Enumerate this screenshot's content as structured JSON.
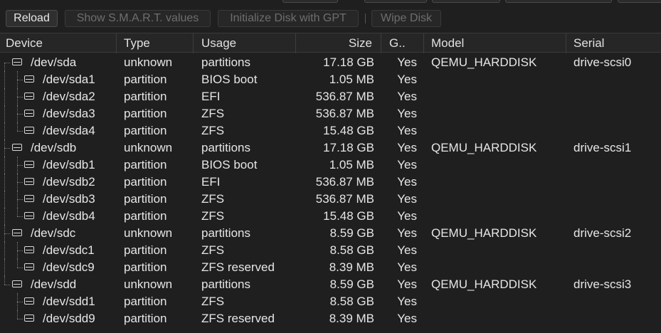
{
  "toolbar": {
    "reload": "Reload",
    "smart": "Show S.M.A.R.T. values",
    "init_gpt": "Initialize Disk with GPT",
    "wipe": "Wipe Disk"
  },
  "columns": {
    "device": "Device",
    "type": "Type",
    "usage": "Usage",
    "size": "Size",
    "gpt": "G..",
    "model": "Model",
    "serial": "Serial"
  },
  "rows": [
    {
      "device": "/dev/sda",
      "type": "unknown",
      "usage": "partitions",
      "size": "17.18 GB",
      "gpt": "Yes",
      "model": "QEMU_HARDDISK",
      "serial": "drive-scsi0"
    },
    {
      "device": "/dev/sda1",
      "type": "partition",
      "usage": "BIOS boot",
      "size": "1.05 MB",
      "gpt": "Yes",
      "model": "",
      "serial": ""
    },
    {
      "device": "/dev/sda2",
      "type": "partition",
      "usage": "EFI",
      "size": "536.87 MB",
      "gpt": "Yes",
      "model": "",
      "serial": ""
    },
    {
      "device": "/dev/sda3",
      "type": "partition",
      "usage": "ZFS",
      "size": "536.87 MB",
      "gpt": "Yes",
      "model": "",
      "serial": ""
    },
    {
      "device": "/dev/sda4",
      "type": "partition",
      "usage": "ZFS",
      "size": "15.48 GB",
      "gpt": "Yes",
      "model": "",
      "serial": ""
    },
    {
      "device": "/dev/sdb",
      "type": "unknown",
      "usage": "partitions",
      "size": "17.18 GB",
      "gpt": "Yes",
      "model": "QEMU_HARDDISK",
      "serial": "drive-scsi1"
    },
    {
      "device": "/dev/sdb1",
      "type": "partition",
      "usage": "BIOS boot",
      "size": "1.05 MB",
      "gpt": "Yes",
      "model": "",
      "serial": ""
    },
    {
      "device": "/dev/sdb2",
      "type": "partition",
      "usage": "EFI",
      "size": "536.87 MB",
      "gpt": "Yes",
      "model": "",
      "serial": ""
    },
    {
      "device": "/dev/sdb3",
      "type": "partition",
      "usage": "ZFS",
      "size": "536.87 MB",
      "gpt": "Yes",
      "model": "",
      "serial": ""
    },
    {
      "device": "/dev/sdb4",
      "type": "partition",
      "usage": "ZFS",
      "size": "15.48 GB",
      "gpt": "Yes",
      "model": "",
      "serial": ""
    },
    {
      "device": "/dev/sdc",
      "type": "unknown",
      "usage": "partitions",
      "size": "8.59 GB",
      "gpt": "Yes",
      "model": "QEMU_HARDDISK",
      "serial": "drive-scsi2"
    },
    {
      "device": "/dev/sdc1",
      "type": "partition",
      "usage": "ZFS",
      "size": "8.58 GB",
      "gpt": "Yes",
      "model": "",
      "serial": ""
    },
    {
      "device": "/dev/sdc9",
      "type": "partition",
      "usage": "ZFS reserved",
      "size": "8.39 MB",
      "gpt": "Yes",
      "model": "",
      "serial": ""
    },
    {
      "device": "/dev/sdd",
      "type": "unknown",
      "usage": "partitions",
      "size": "8.59 GB",
      "gpt": "Yes",
      "model": "QEMU_HARDDISK",
      "serial": "drive-scsi3"
    },
    {
      "device": "/dev/sdd1",
      "type": "partition",
      "usage": "ZFS",
      "size": "8.58 GB",
      "gpt": "Yes",
      "model": "",
      "serial": ""
    },
    {
      "device": "/dev/sdd9",
      "type": "partition",
      "usage": "ZFS reserved",
      "size": "8.39 MB",
      "gpt": "Yes",
      "model": "",
      "serial": ""
    }
  ]
}
